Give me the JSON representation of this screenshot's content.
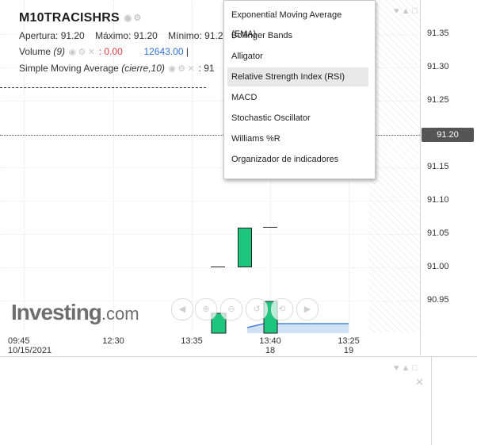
{
  "header": {
    "symbol": "M10TRACISHRS",
    "open_label": "Apertura:",
    "open_value": "91.20",
    "high_label": "Máximo:",
    "high_value": "91.20",
    "low_label": "Mínimo:",
    "low_value": "91.2",
    "volume_label": "Volume",
    "volume_period": "(9)",
    "volume_change": ": 0.00",
    "volume_value": "12643.00",
    "sma_label": "Simple Moving Average",
    "sma_params": "(cierre,10)",
    "sma_value": ": 91"
  },
  "price_axis": {
    "ticks": [
      "91.35",
      "91.30",
      "91.25",
      "91.15",
      "91.10",
      "91.05",
      "91.00",
      "90.95"
    ],
    "current_price": "91.20"
  },
  "time_axis": {
    "labels": [
      {
        "time": "09:45",
        "date": "10/15/2021"
      },
      {
        "time": "12:30",
        "date": ""
      },
      {
        "time": "13:35",
        "date": ""
      },
      {
        "time": "13:40",
        "date": "18"
      },
      {
        "time": "13:25",
        "date": "19"
      }
    ]
  },
  "indicator_menu": {
    "items": [
      "Exponential Moving Average (EMA)",
      "Bollinger Bands",
      "Alligator",
      "Relative Strength Index (RSI)",
      "MACD",
      "Stochastic Oscillator",
      "Williams %R",
      "Organizador de indicadores"
    ],
    "active_index": 3
  },
  "branding": {
    "logo_main": "Investing",
    "logo_suffix": ".com"
  },
  "colors": {
    "up_candle": "#1dc57d",
    "volume_area": "#2d6fd3",
    "price_tag": "#555555"
  }
}
